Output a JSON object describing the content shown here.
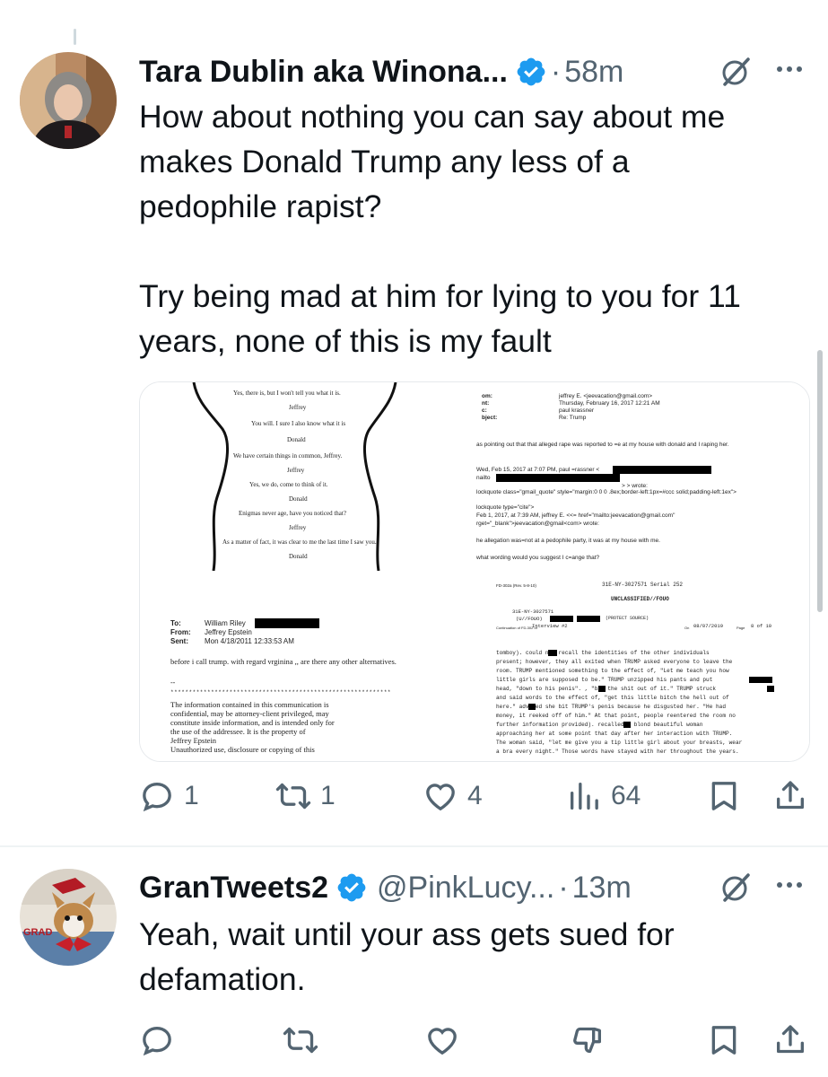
{
  "tweet1": {
    "display_name": "Tara Dublin aka Winona...",
    "time": "58m",
    "text": "How about nothing you can say about me\nmakes Donald Trump any less of a\npedophile rapist?\n\nTry being mad at him for lying to you for 11\nyears, none of this is my fault",
    "media": {
      "doc1": {
        "lines": [
          "Yes, there is, but I won't tell you what it is.",
          "Jeffrey",
          "You will. I sure I also know what it is",
          "Donald",
          "We have certain things in common, Jeffrey.",
          "Jeffrey",
          "Yes, we do, come to think of it.",
          "Donald",
          "Enigmas never age, have you noticed that?",
          "Jeffrey",
          "As a matter of fact, it was clear to me the last time I saw you.",
          "Donald"
        ]
      },
      "doc2": {
        "labels": [
          "om:",
          "nt:",
          "c:",
          "bject:"
        ],
        "values": [
          "jeffrey E. <jeevacation@gmail.com>",
          "Thursday, February 16, 2017 12:21 AM",
          "paul krassner",
          "Re: Trump"
        ],
        "body": [
          "as pointing out that that alleged rape was reported to =e at my house with donald and I raping her.",
          "Wed, Feb 15, 2017 at 7:07 PM, paul =rassner <",
          "nailto",
          "> > wrote:",
          "lockquote class=\"gmail_quote\" style=\"margin:0 0 0 .8ex;border-left:1px=#ccc solid;padding-left:1ex\">",
          "lockquote type=\"cite\">",
          "Feb 1, 2017, at 7:39 AM, jeffrey E. <<= href=\"mailto:jeevacation@gmail.com\"",
          "rget=\"_blank\">jeevacation@gmail<com> wrote:",
          "he allegation was=not at a pedophile party,   it was at my house with me.",
          "what wording would you suggest I c=ange that?"
        ]
      },
      "doc3": {
        "labels": [
          "To:",
          "From:",
          "Sent:"
        ],
        "values": [
          "William Riley",
          "Jeffrey Epstein",
          "Mon 4/18/2011 12:33:53 AM"
        ],
        "body": "before i call trump. with regard vrginina ,, are there any other alternatives.",
        "dash": "--",
        "stars": "************************************************************",
        "notice": [
          "The information contained in this communication is",
          "confidential, may be attorney-client privileged, may",
          "constitute inside information, and is intended only for",
          "the use of the addressee. It is the property of",
          "Jeffrey Epstein",
          "Unauthorized use, disclosure or copying of this"
        ]
      },
      "doc4": {
        "form": "FD-302a (Rev. 5-8-10)",
        "serial": "31E-NY-3027571 Serial 252",
        "classification": "UNCLASSIFIED//FOUO",
        "case": "31E-NY-3027571",
        "fouo": "(U//FOUO)",
        "protect": "(PROTECT SOURCE)",
        "cont_label": "Continuation of FD-302 of",
        "interview": "Interview #2",
        "on_label": "On",
        "date": "08/07/2019",
        "page_label": "Page",
        "page": "8 of 10",
        "body": [
          "tomboy).     could not recall the identities of the other individuals",
          "present; however, they all exited when TRUMP asked everyone to leave the",
          "room.  TRUMP mentioned something to the effect of, \"Let me teach you how",
          "little girls are supposed to be.\"  TRUMP unzipped his pants and put",
          "head, \"down to his penis\".    , \"bit the shit out of it.\"  TRUMP struck",
          "and said words to the effect of, \"get this little bitch the hell out of",
          "here.\"    advised she bit TRUMP's penis because he disgusted her.  \"He had",
          "money, it reeked off of him.\"  At that point, people reentered the room no",
          "further information provided).     recalled a blond beautiful woman",
          "approaching her at some point that day after her interaction with TRUMP.",
          "The woman said, \"let me give you a tip little girl about your breasts, wear",
          "a bra every night.\"  Those words have stayed with her throughout the years."
        ]
      }
    },
    "actions": {
      "replies": "1",
      "reposts": "1",
      "likes": "4",
      "views": "64"
    }
  },
  "tweet2": {
    "display_name": "GranTweets2",
    "handle": "@PinkLucy...",
    "time": "13m",
    "text": "Yeah, wait until your ass gets sued for\ndefamation.",
    "avatar_text": "GRAD"
  },
  "colors": {
    "verified": "#1d9bf0",
    "muted": "#536471",
    "text": "#0f1419"
  },
  "icons": [
    "verified-badge-icon",
    "grok-icon",
    "more-icon",
    "reply-icon",
    "repost-icon",
    "like-icon",
    "views-icon",
    "bookmark-icon",
    "share-icon",
    "dislike-icon"
  ]
}
